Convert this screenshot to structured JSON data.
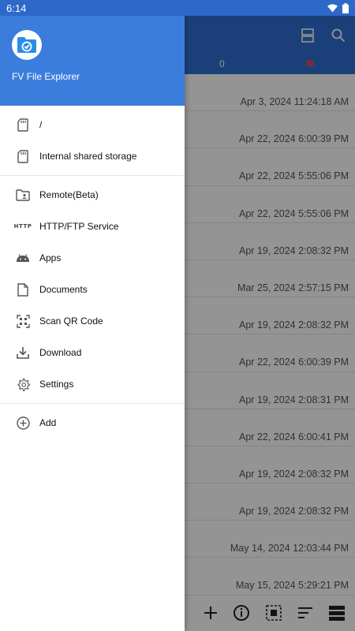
{
  "status": {
    "time": "6:14"
  },
  "app": {
    "name": "FV File Explorer"
  },
  "drawer": {
    "storage": [
      {
        "label": "/",
        "icon": "sd-card-icon"
      },
      {
        "label": "Internal shared storage",
        "icon": "sd-card-icon"
      }
    ],
    "services": [
      {
        "label": "Remote(Beta)",
        "icon": "folder-account-icon"
      },
      {
        "label": "HTTP/FTP Service",
        "icon": "http-icon"
      },
      {
        "label": "Apps",
        "icon": "android-icon"
      },
      {
        "label": "Documents",
        "icon": "document-icon"
      },
      {
        "label": "Scan QR Code",
        "icon": "qr-scan-icon"
      },
      {
        "label": "Download",
        "icon": "download-icon"
      },
      {
        "label": "Settings",
        "icon": "gear-icon"
      }
    ],
    "extra": [
      {
        "label": "Add",
        "icon": "add-circle-icon"
      }
    ]
  },
  "background": {
    "tab_count": "0",
    "dates": [
      "Apr 3, 2024 11:24:18 AM",
      "Apr 22, 2024 6:00:39 PM",
      "Apr 22, 2024 5:55:06 PM",
      "Apr 22, 2024 5:55:06 PM",
      "Apr 19, 2024 2:08:32 PM",
      "Mar 25, 2024 2:57:15 PM",
      "Apr 19, 2024 2:08:32 PM",
      "Apr 22, 2024 6:00:39 PM",
      "Apr 19, 2024 2:08:31 PM",
      "Apr 22, 2024 6:00:41 PM",
      "Apr 19, 2024 2:08:32 PM",
      "Apr 19, 2024 2:08:32 PM",
      "May 14, 2024 12:03:44 PM",
      "May 15, 2024 5:29:21 PM"
    ]
  },
  "colors": {
    "header_blue": "#3b7ddd",
    "appbar_blue": "#2f6fd1"
  }
}
